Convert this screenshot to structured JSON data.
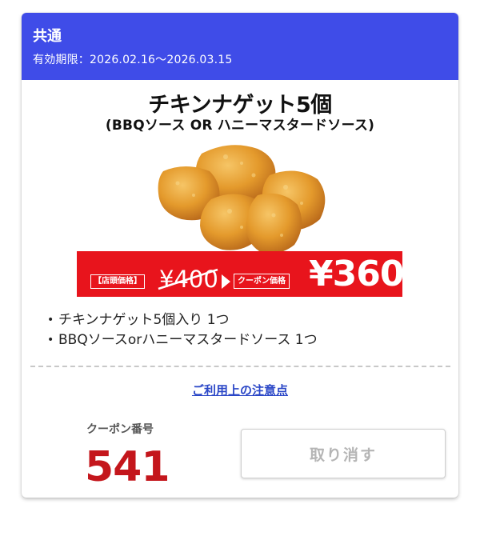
{
  "header": {
    "title": "共通",
    "validity": "有効期限：2026.02.16〜2026.03.15",
    "background_color": "#3f4ce8"
  },
  "product": {
    "title": "チキンナゲット5個",
    "subtitle": "(BBQソース OR ハニーマスタードソース)",
    "image_icon": "chicken-nuggets-image"
  },
  "price": {
    "store_label": "【店頭価格】",
    "store_price": "¥400",
    "coupon_label": "クーポン価格",
    "coupon_price": "¥360",
    "banner_color": "#e8141c"
  },
  "items": [
    {
      "text": "チキンナゲット5個入り 1つ"
    },
    {
      "text": "BBQソースorハニーマスタードソース 1つ"
    }
  ],
  "notes_link": "ご利用上の注意点",
  "coupon": {
    "label": "クーポン番号",
    "number": "541",
    "number_color": "#c4161c"
  },
  "cancel_button": "取り消す"
}
